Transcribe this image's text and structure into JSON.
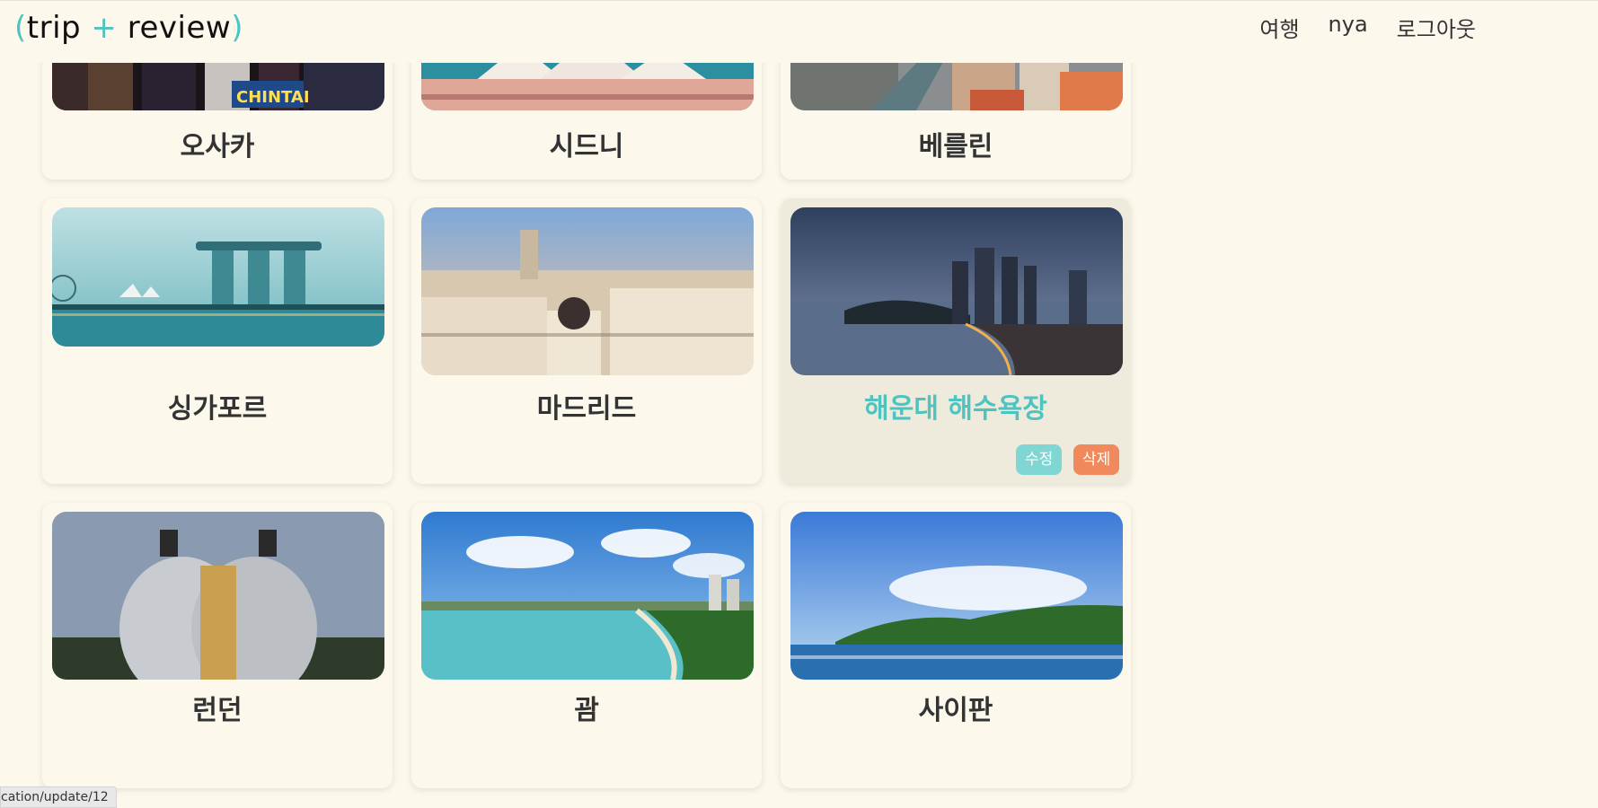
{
  "header": {
    "logo": {
      "open": "(",
      "left": "trip",
      "plus": "+",
      "right": "review",
      "close": ")"
    },
    "nav": [
      "여행",
      "nya",
      "로그아웃"
    ]
  },
  "cards": [
    {
      "title": "오사카"
    },
    {
      "title": "시드니"
    },
    {
      "title": "베를린"
    },
    {
      "title": "싱가포르"
    },
    {
      "title": "마드리드"
    },
    {
      "title": "해운대 해수욕장",
      "edit": "수정",
      "delete": "삭제"
    },
    {
      "title": "런던"
    },
    {
      "title": "괌"
    },
    {
      "title": "사이판"
    }
  ],
  "status_bar": "cation/update/12",
  "colors": {
    "accent": "#4fc3c0",
    "edit": "#7fd6d3",
    "delete": "#f08a5d",
    "background": "#fcf8ec"
  }
}
